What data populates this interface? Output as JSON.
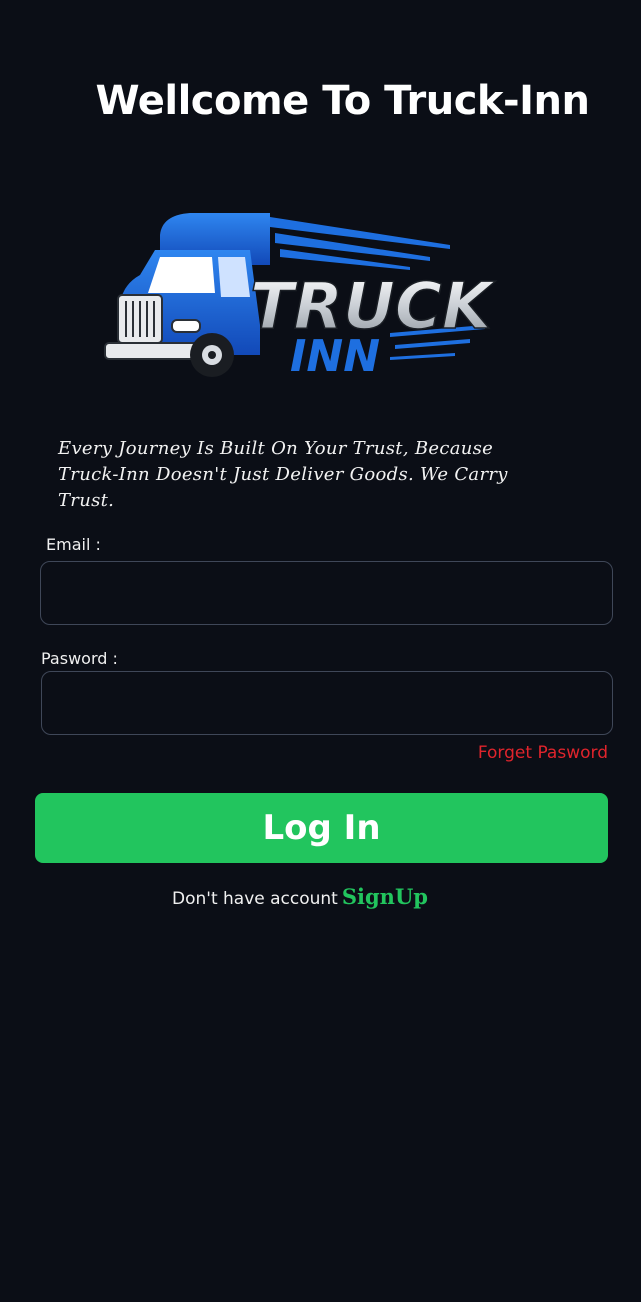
{
  "header": {
    "title": "Wellcome To Truck-Inn"
  },
  "logo": {
    "word1": "TRUCK",
    "word2": "INN",
    "colors": {
      "blue": "#1e6fe0",
      "dark_blue": "#0d3f9e",
      "silver": "#d9dde2"
    }
  },
  "tagline": "Every Journey Is Built On Your Trust, Because Truck-Inn Doesn't Just Deliver Goods. We Carry Trust.",
  "form": {
    "email_label": "Email :",
    "email_value": "",
    "password_label": "Pasword :",
    "password_value": "",
    "forgot_label": "Forget Pasword",
    "login_label": "Log In"
  },
  "footer": {
    "prompt": "Don't have account",
    "signup_label": "SignUp"
  },
  "colors": {
    "background": "#0b0e16",
    "accent_green": "#22c55e",
    "link_red": "#e0242c",
    "field_border": "#3f4758"
  }
}
